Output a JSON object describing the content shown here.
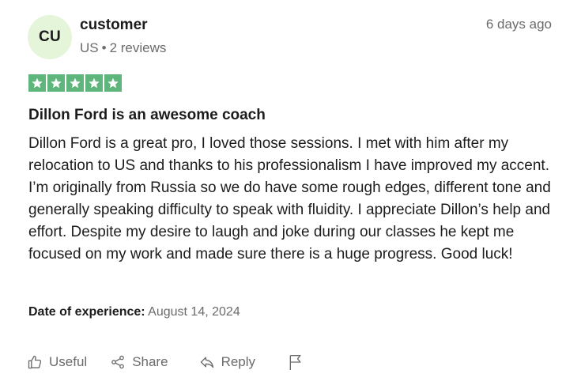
{
  "reviewer": {
    "initials": "CU",
    "name": "customer",
    "country": "US",
    "separator": "•",
    "review_count": "2 reviews"
  },
  "posted_ago": "6 days ago",
  "rating": {
    "stars": 5,
    "max": 5,
    "color": "#5fb67d"
  },
  "review": {
    "title": "Dillon Ford is an awesome coach",
    "body": "Dillon Ford is a great pro, I loved those sessions. I met with him after my relocation to US and thanks to his professionalism I have improved my accent. I’m originally from Russia so we do have some rough edges, different tone and generally speaking difficulty to speak with fluidity. I appreciate Dillon’s help and effort. Despite my desire to laugh and joke during our classes he kept me focused on my work and made sure there is a huge progress. Good luck!"
  },
  "experience": {
    "label": "Date of experience:",
    "date": "August 14, 2024"
  },
  "actions": {
    "useful": "Useful",
    "share": "Share",
    "reply": "Reply"
  },
  "icons": {
    "useful": "thumbs-up-icon",
    "share": "share-icon",
    "reply": "reply-icon",
    "flag": "flag-icon",
    "star": "star-icon"
  },
  "colors": {
    "avatar_bg": "#e5f5d9",
    "muted_text": "#6b6b6b",
    "text": "#1c1c1c"
  }
}
